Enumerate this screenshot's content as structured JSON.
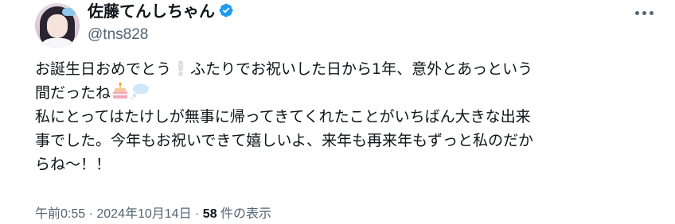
{
  "author": {
    "display_name": "佐藤てんしちゃん",
    "handle": "@tns828",
    "verified": true
  },
  "icons": {
    "avatar": "profile-avatar",
    "verified": "verified-badge-icon",
    "more": "more-options-icon",
    "exclamation": "white-exclamation-emoji",
    "cake": "birthday-cake-emoji",
    "cloud": "thought-balloon-emoji"
  },
  "colors": {
    "text": "#0f1419",
    "secondary": "#536471",
    "verified": "#1d9bf0"
  },
  "tweet": {
    "line1_a": "お誕生日おめでとう",
    "line1_b": "ふたりでお祝いした日から1年、意外とあっという",
    "line2_a": "間だったね",
    "line3": "私にとってはたけしが無事に帰ってきてくれたことがいちばん大きな出来",
    "line4": "事でした。今年もお祝いできて嬉しいよ、来年も再来年もずっと私のだか",
    "line5": "らね〜！！"
  },
  "meta": {
    "time": "午前0:55",
    "separator1": " · ",
    "date": "2024年10月14日",
    "separator2": " · ",
    "views_count": "58",
    "views_label": " 件の表示"
  }
}
